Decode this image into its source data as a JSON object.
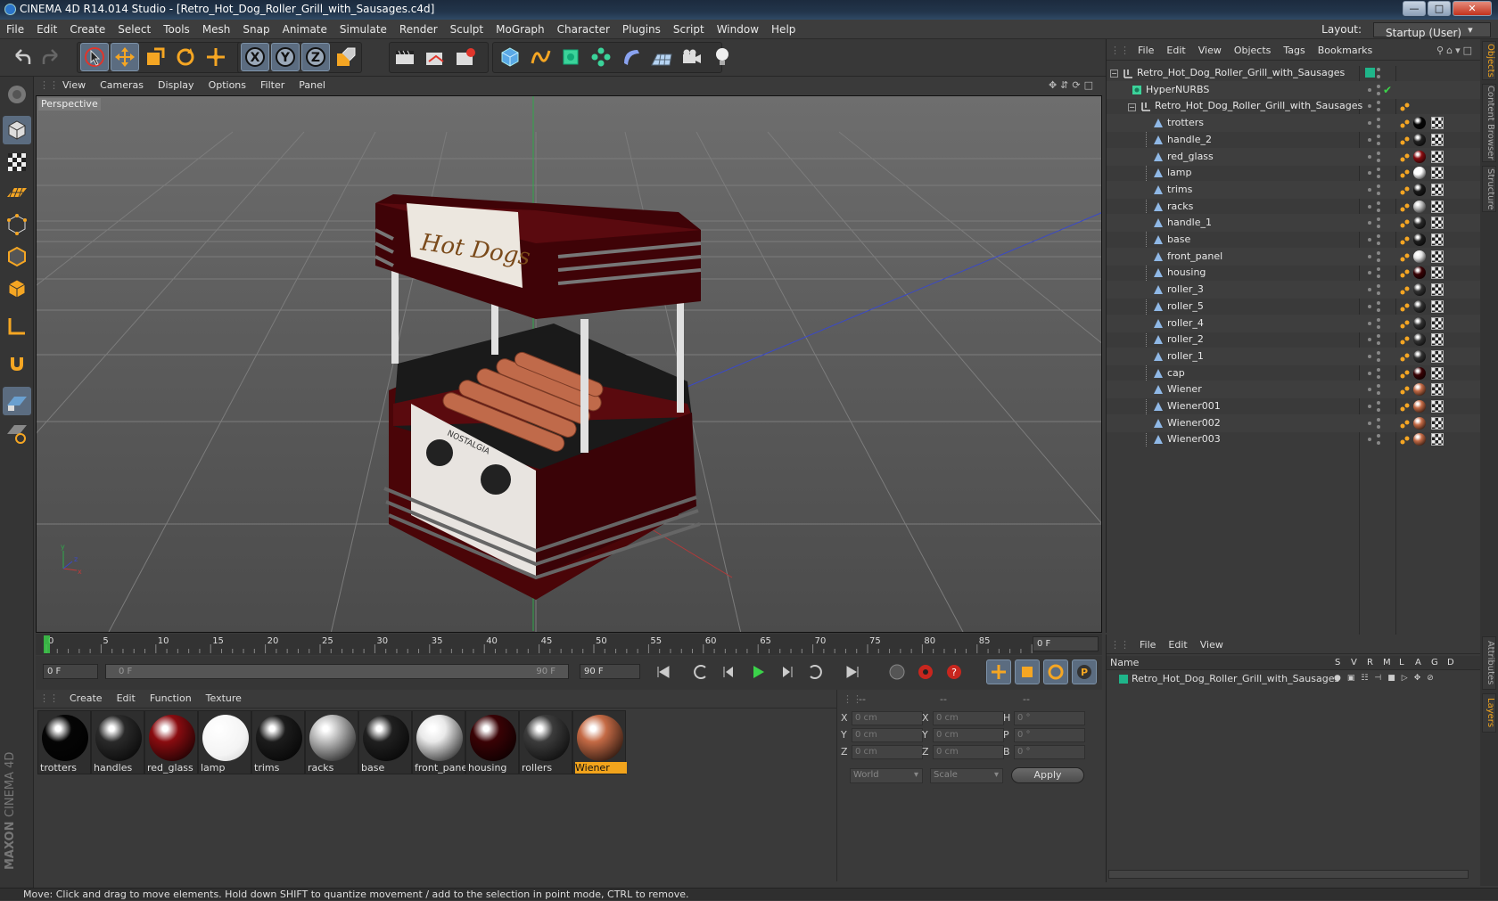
{
  "window": {
    "title": "CINEMA 4D R14.014 Studio - [Retro_Hot_Dog_Roller_Grill_with_Sausages.c4d]"
  },
  "menubar": [
    "File",
    "Edit",
    "Create",
    "Select",
    "Tools",
    "Mesh",
    "Snap",
    "Animate",
    "Simulate",
    "Render",
    "Sculpt",
    "MoGraph",
    "Character",
    "Plugins",
    "Script",
    "Window",
    "Help"
  ],
  "layout": {
    "label": "Layout:",
    "value": "Startup (User)"
  },
  "viewport": {
    "menu": [
      "View",
      "Cameras",
      "Display",
      "Options",
      "Filter",
      "Panel"
    ],
    "label": "Perspective",
    "product": {
      "sign": "Hot Dogs",
      "brand": "NOSTALGIA"
    }
  },
  "timeline": {
    "ticks": [
      "0",
      "5",
      "10",
      "15",
      "20",
      "25",
      "30",
      "35",
      "40",
      "45",
      "50",
      "55",
      "60",
      "65",
      "70",
      "75",
      "80",
      "85",
      "90"
    ],
    "end_frame": "0 F",
    "current": "0 F",
    "range_start": "0 F",
    "range_end": "90 F",
    "max": "90 F"
  },
  "materials": {
    "menu": [
      "Create",
      "Edit",
      "Function",
      "Texture"
    ],
    "items": [
      {
        "label": "trotters",
        "color": "#050505"
      },
      {
        "label": "handles",
        "color": "#2a2a2a"
      },
      {
        "label": "red_glass",
        "color": "#8a0c10"
      },
      {
        "label": "lamp",
        "color": "#ffffff"
      },
      {
        "label": "trims",
        "color": "#1c1c1c"
      },
      {
        "label": "racks",
        "color": "#bdbdbd"
      },
      {
        "label": "base",
        "color": "#202020"
      },
      {
        "label": "front_pane",
        "color": "#e9e9e9"
      },
      {
        "label": "housing",
        "color": "#3a0205"
      },
      {
        "label": "rollers",
        "color": "#3c3c3c"
      },
      {
        "label": "Wiener",
        "color": "#c46a45",
        "selected": true
      }
    ]
  },
  "coords": {
    "headers": [
      "--",
      "--",
      "--"
    ],
    "rows": [
      {
        "a": "X",
        "av": "0 cm",
        "b": "X",
        "bv": "0 cm",
        "c": "H",
        "cv": "0 °"
      },
      {
        "a": "Y",
        "av": "0 cm",
        "b": "Y",
        "bv": "0 cm",
        "c": "P",
        "cv": "0 °"
      },
      {
        "a": "Z",
        "av": "0 cm",
        "b": "Z",
        "bv": "0 cm",
        "c": "B",
        "cv": "0 °"
      }
    ],
    "mode": "World",
    "scale": "Scale",
    "apply": "Apply"
  },
  "objects": {
    "menu": [
      "File",
      "Edit",
      "View",
      "Objects",
      "Tags",
      "Bookmarks"
    ],
    "root": "Retro_Hot_Dog_Roller_Grill_with_Sausages",
    "nurbs": "HyperNURBS",
    "group": "Retro_Hot_Dog_Roller_Grill_with_Sausages",
    "children": [
      {
        "name": "trotters",
        "mat": "#060606"
      },
      {
        "name": "handle_2",
        "mat": "#222222"
      },
      {
        "name": "red_glass",
        "mat": "#8a0c10"
      },
      {
        "name": "lamp",
        "mat": "#ffffff"
      },
      {
        "name": "trims",
        "mat": "#1a1a1a"
      },
      {
        "name": "racks",
        "mat": "#bdbdbd"
      },
      {
        "name": "handle_1",
        "mat": "#2a2a2a"
      },
      {
        "name": "base",
        "mat": "#1e1e1e"
      },
      {
        "name": "front_panel",
        "mat": "#e6e6e6"
      },
      {
        "name": "housing",
        "mat": "#3a0205"
      },
      {
        "name": "roller_3",
        "mat": "#333333"
      },
      {
        "name": "roller_5",
        "mat": "#333333"
      },
      {
        "name": "roller_4",
        "mat": "#333333"
      },
      {
        "name": "roller_2",
        "mat": "#333333"
      },
      {
        "name": "roller_1",
        "mat": "#333333"
      },
      {
        "name": "cap",
        "mat": "#3a0205"
      },
      {
        "name": "Wiener",
        "mat": "#c46a45"
      },
      {
        "name": "Wiener001",
        "mat": "#c46a45"
      },
      {
        "name": "Wiener002",
        "mat": "#c46a45"
      },
      {
        "name": "Wiener003",
        "mat": "#c46a45"
      }
    ]
  },
  "layers": {
    "menu": [
      "File",
      "Edit",
      "View"
    ],
    "cols": {
      "name": "Name",
      "flags": [
        "S",
        "V",
        "R",
        "M",
        "L",
        "A",
        "G",
        "D"
      ]
    },
    "row": "Retro_Hot_Dog_Roller_Grill_with_Sausages"
  },
  "sidetabs": [
    "Objects",
    "Content Browser",
    "Structure",
    "Attributes",
    "Layers"
  ],
  "status": "Move: Click and drag to move elements. Hold down SHIFT to quantize movement / add to the selection in point mode, CTRL to remove.",
  "colors": {
    "accent": "#f2a41c",
    "layer": "#1fb58a",
    "selection": "#5b6c80"
  }
}
